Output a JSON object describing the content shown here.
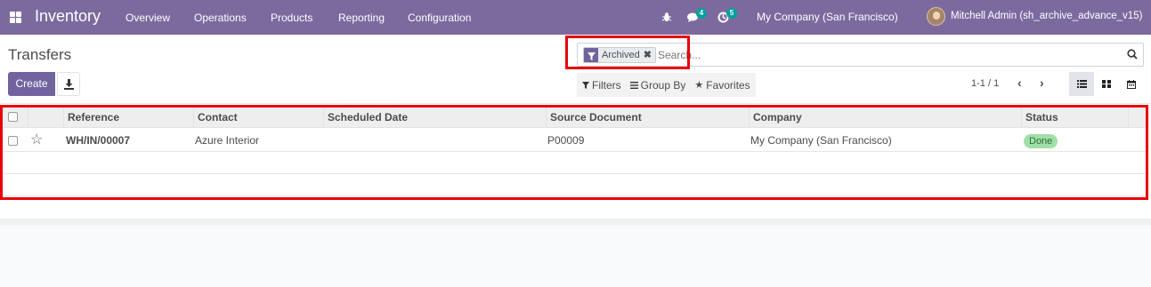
{
  "navbar": {
    "brand": "Inventory",
    "menu": [
      "Overview",
      "Operations",
      "Products",
      "Reporting",
      "Configuration"
    ],
    "messages_badge": "4",
    "activities_badge": "5",
    "company": "My Company (San Francisco)",
    "user": "Mitchell Admin (sh_archive_advance_v15)",
    "colors": {
      "bar": "#7c6a9f",
      "badge": "#00a09d"
    }
  },
  "control_panel": {
    "title": "Transfers",
    "create_label": "Create",
    "search": {
      "facet_label": "Archived",
      "placeholder": "Search..."
    },
    "filters_label": "Filters",
    "groupby_label": "Group By",
    "favorites_label": "Favorites",
    "pager": "1-1 / 1"
  },
  "table": {
    "columns": [
      "Reference",
      "Contact",
      "Scheduled Date",
      "Source Document",
      "Company",
      "Status"
    ],
    "rows": [
      {
        "reference": "WH/IN/00007",
        "contact": "Azure Interior",
        "scheduled_date": "",
        "source_document": "P00009",
        "company": "My Company (San Francisco)",
        "status": "Done"
      }
    ]
  },
  "accent_colors": {
    "primary": "#71639e",
    "highlight": "#e8000b",
    "done_badge": "#9fe0a8"
  }
}
